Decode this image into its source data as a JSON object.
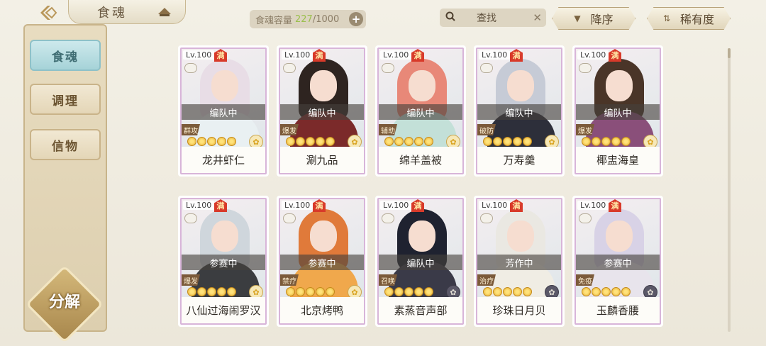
{
  "header": {
    "title": "食魂",
    "capacity_label": "食魂容量",
    "capacity_current": "227",
    "capacity_max": "/1000",
    "capacity_plus": "+",
    "search_label": "查找",
    "search_clear": "✕",
    "sort_order_label": "降序",
    "sort_rarity_label": "稀有度"
  },
  "sidebar": {
    "items": [
      {
        "label": "食魂",
        "active": true
      },
      {
        "label": "调理",
        "active": false
      },
      {
        "label": "信物",
        "active": false
      }
    ],
    "decompose_label": "分解"
  },
  "cards": [
    {
      "level": "Lv.100",
      "full": "满",
      "status": "编队中",
      "role": "群攻",
      "name": "龙井虾仁",
      "stars": 5,
      "badge": "flower",
      "hair": "#e8dde6",
      "body": "#e9f0f2"
    },
    {
      "level": "Lv.100",
      "full": "满",
      "status": "编队中",
      "role": "爆发",
      "name": "涮九品",
      "stars": 5,
      "badge": "flower",
      "hair": "#2e2420",
      "body": "#7b2a2a"
    },
    {
      "level": "Lv.100",
      "full": "满",
      "status": "编队中",
      "role": "辅助",
      "name": "绵羊盖被",
      "stars": 5,
      "badge": "flower",
      "hair": "#e88878",
      "body": "#c3e0d8"
    },
    {
      "level": "Lv.100",
      "full": "满",
      "status": "编队中",
      "role": "破防",
      "name": "万寿羹",
      "stars": 5,
      "badge": "flower",
      "hair": "#c6cbd6",
      "body": "#2d2f3a"
    },
    {
      "level": "Lv.100",
      "full": "满",
      "status": "编队中",
      "role": "爆发",
      "name": "椰盅海皇",
      "stars": 5,
      "badge": "flower",
      "hair": "#4a3528",
      "body": "#8a4f7a"
    },
    {
      "level": "Lv.100",
      "full": "满",
      "status": "参赛中",
      "role": "爆发",
      "name": "八仙过海闹罗汉",
      "stars": 5,
      "badge": "flower",
      "hair": "#cfd6dc",
      "body": "#3b3d40"
    },
    {
      "level": "Lv.100",
      "full": "满",
      "status": "参赛中",
      "role": "禁疗",
      "name": "北京烤鸭",
      "stars": 5,
      "badge": "flower",
      "hair": "#e07a3a",
      "body": "#f0a84c"
    },
    {
      "level": "Lv.100",
      "full": "满",
      "status": "编队中",
      "role": "召唤",
      "name": "素蒸音声部",
      "stars": 5,
      "badge": "dark",
      "hair": "#1f2230",
      "body": "#3a3a48"
    },
    {
      "level": "Lv.100",
      "full": "满",
      "status": "芳作中",
      "role": "治疗",
      "name": "珍珠日月贝",
      "stars": 5,
      "badge": "dark",
      "hair": "#eae8e2",
      "body": "#f0ede4"
    },
    {
      "level": "Lv.100",
      "full": "满",
      "status": "参赛中",
      "role": "免疫",
      "name": "玉麟香腰",
      "stars": 5,
      "badge": "dark",
      "hair": "#d8d2e6",
      "body": "#e8e4ec"
    }
  ],
  "colors": {
    "accent": "#9bbf4c",
    "tab_active": "#a6d3d8",
    "gold": "#d4b87a"
  }
}
